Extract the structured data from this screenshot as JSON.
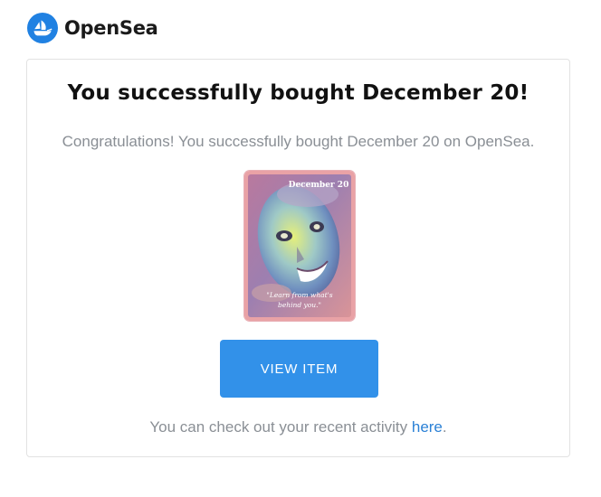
{
  "brand": {
    "name": "OpenSea",
    "logo_icon": "opensea-boat-icon",
    "logo_color": "#2081e2"
  },
  "email": {
    "title": "You successfully bought December 20!",
    "message": "Congratulations! You successfully bought December 20 on OpenSea.",
    "nft": {
      "card_title": "December 20",
      "card_quote_line1": "\"Learn from what's",
      "card_quote_line2": "behind you.\""
    },
    "view_button_label": "VIEW ITEM",
    "footer_prefix": "You can check out your recent activity ",
    "footer_link": "here",
    "footer_suffix": "."
  },
  "colors": {
    "button": "#3291e9",
    "link": "#2b81d6",
    "muted_text": "#8a8f95"
  }
}
